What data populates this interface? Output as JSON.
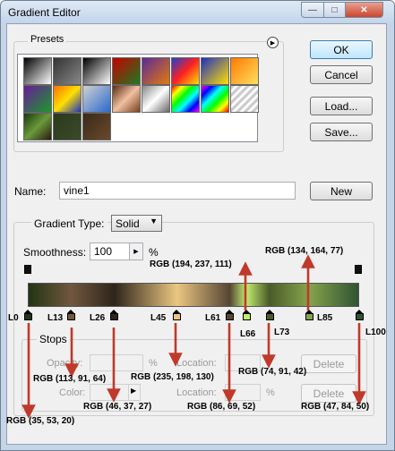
{
  "window": {
    "title": "Gradient Editor"
  },
  "presets": {
    "label": "Presets"
  },
  "buttons": {
    "ok": "OK",
    "cancel": "Cancel",
    "load": "Load...",
    "save": "Save...",
    "new": "New"
  },
  "name": {
    "label": "Name:",
    "value": "vine1"
  },
  "gradient": {
    "type_label": "Gradient Type:",
    "type_value": "Solid",
    "smoothness_label": "Smoothness:",
    "smoothness_value": "100",
    "smoothness_unit": "%"
  },
  "stop_labels": [
    "L0",
    "L13",
    "L26",
    "L45",
    "L61",
    "L66",
    "L73",
    "L85",
    "L100"
  ],
  "stop_colors": [
    "#233514",
    "#71573f",
    "#2e251b",
    "#ebc682",
    "#564534",
    "#c2ed6f",
    "#4a5b2a",
    "#86a44d",
    "#2f5432"
  ],
  "annotations": [
    "RGB (194, 237, 111)",
    "RGB (134, 164, 77)",
    "RGB (113, 91, 64)",
    "RGB (235, 198, 130)",
    "RGB (74, 91, 42)",
    "RGB (46, 37, 27)",
    "RGB (86, 69, 52)",
    "RGB (47, 84, 50)",
    "RGB (35, 53, 20)"
  ],
  "stops": {
    "label": "Stops",
    "opacity_label": "Opacity:",
    "opacity_unit": "%",
    "location_label": "Location:",
    "location_unit": "%",
    "color_label": "Color:",
    "delete": "Delete"
  },
  "arrow_color": "#c0392b"
}
